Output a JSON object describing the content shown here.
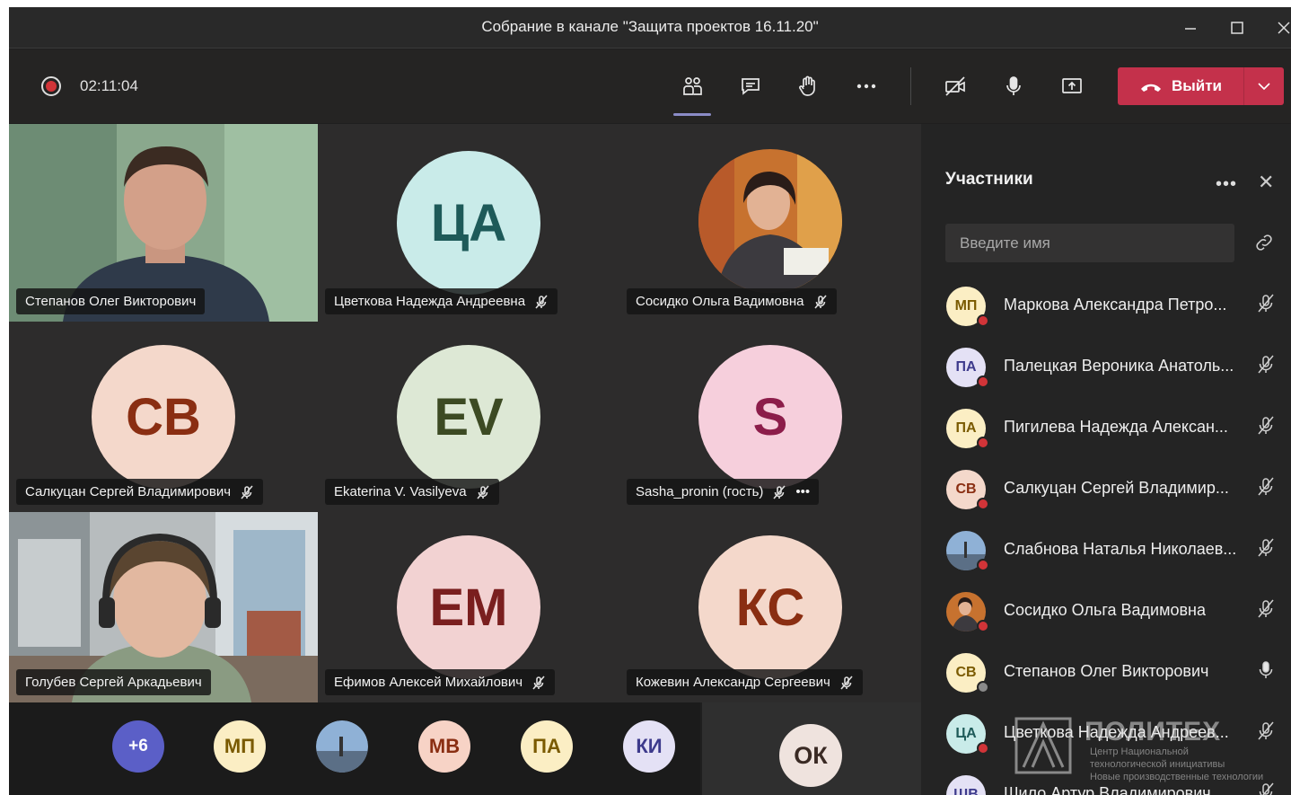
{
  "window": {
    "title": "Собрание в канале \"Защита проектов 16.11.20\""
  },
  "toolbar": {
    "timer": "02:11:04",
    "leave_label": "Выйти"
  },
  "tiles": [
    {
      "name": "Степанов Олег Викторович",
      "video": "man-green",
      "muted": false
    },
    {
      "name": "Цветкова Надежда Андреевна",
      "initials": "ЦА",
      "avatar_bg": "#c9ebe9",
      "avatar_fg": "#1e5a59",
      "muted": true
    },
    {
      "name": "Сосидко Ольга Вадимовна",
      "photo": "woman-portrait",
      "muted": true
    },
    {
      "name": "Салкуцан Сергей Владимирович",
      "initials": "СВ",
      "avatar_bg": "#f4d8cb",
      "avatar_fg": "#8a2e12",
      "muted": true
    },
    {
      "name": "Ekaterina V. Vasilyeva",
      "initials": "EV",
      "avatar_bg": "#dde8d5",
      "avatar_fg": "#3c4a23",
      "muted": true
    },
    {
      "name": "Sasha_pronin (гость)",
      "initials": "S",
      "avatar_bg": "#f6cfdc",
      "avatar_fg": "#8c1d4a",
      "muted": true,
      "more": "•••"
    },
    {
      "name": "Голубев Сергей Аркадьевич",
      "video": "man-office",
      "muted": false
    },
    {
      "name": "Ефимов Алексей Михайлович",
      "initials": "ЕМ",
      "avatar_bg": "#f2d2d2",
      "avatar_fg": "#7a1f1f",
      "muted": true
    },
    {
      "name": "Кожевин Александр Сергеевич",
      "initials": "КС",
      "avatar_bg": "#f4d8cb",
      "avatar_fg": "#8a2e12",
      "muted": true
    }
  ],
  "strip": [
    {
      "initials": "+6",
      "bg": "#5b5fc7",
      "fg": "#ffffff"
    },
    {
      "initials": "МП",
      "bg": "#fbeec4",
      "fg": "#7a5a00"
    },
    {
      "photo": "landscape"
    },
    {
      "initials": "МВ",
      "bg": "#f7d3c6",
      "fg": "#8a2e12"
    },
    {
      "initials": "ПА",
      "bg": "#fbeec4",
      "fg": "#7a5a00"
    },
    {
      "initials": "КИ",
      "bg": "#e4e1f5",
      "fg": "#3d3a8c"
    }
  ],
  "self_view": {
    "initials": "ОК",
    "bg": "#efe3de",
    "fg": "#3a2a24"
  },
  "participants": {
    "title": "Участники",
    "more": "•••",
    "close": "✕",
    "search_placeholder": "Введите имя",
    "list": [
      {
        "initials": "МП",
        "bg": "#fbeec4",
        "fg": "#7a5a00",
        "name": "Маркова Александра Петро...",
        "mic": "off"
      },
      {
        "initials": "ПА",
        "bg": "#e4e1f5",
        "fg": "#3d3a8c",
        "name": "Палецкая Вероника Анатоль...",
        "mic": "off"
      },
      {
        "initials": "ПА",
        "bg": "#fbeec4",
        "fg": "#7a5a00",
        "name": "Пигилева Надежда Алексан...",
        "mic": "off"
      },
      {
        "initials": "СВ",
        "bg": "#f4d8cb",
        "fg": "#8a2e12",
        "name": "Салкуцан Сергей Владимир...",
        "mic": "off"
      },
      {
        "photo": "landscape",
        "name": "Слабнова Наталья Николаев...",
        "mic": "off"
      },
      {
        "photo": "woman-portrait",
        "name": "Сосидко Ольга Вадимовна",
        "mic": "off"
      },
      {
        "initials": "СВ",
        "bg": "#fbeec4",
        "fg": "#7a5a00",
        "name": "Степанов Олег Викторович",
        "mic": "on",
        "status": "grey"
      },
      {
        "initials": "ЦА",
        "bg": "#c9ebe9",
        "fg": "#1e5a59",
        "name": "Цветкова Надежда Андреев...",
        "mic": "off"
      },
      {
        "initials": "ШВ",
        "bg": "#e4e1f5",
        "fg": "#3d3a8c",
        "name": "Шило Артур Владимирович",
        "mic": "off"
      }
    ]
  },
  "watermark": {
    "name": "ПОЛИТЕХ",
    "line1": "Центр Национальной",
    "line2": "технологической инициативы",
    "line3": "Новые производственные технологии"
  }
}
